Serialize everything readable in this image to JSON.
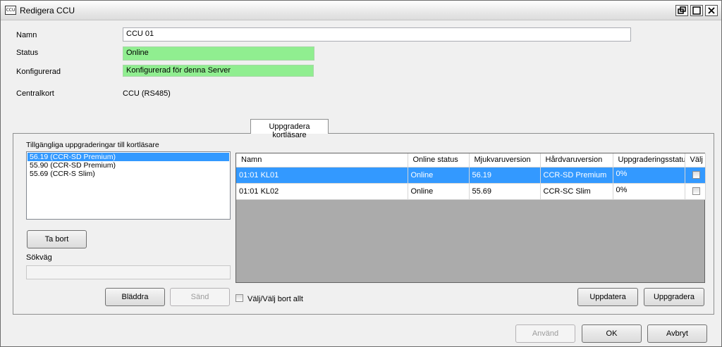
{
  "window": {
    "title": "Redigera CCU",
    "icon_text": "CCU"
  },
  "form": {
    "name_label": "Namn",
    "name_value": "CCU 01",
    "status_label": "Status",
    "status_value": "Online",
    "configured_label": "Konfigurerad",
    "configured_value": "Konfigurerad för denna Server",
    "board_label": "Centralkort",
    "board_value": "CCU (RS485)"
  },
  "tab": {
    "label": "Uppgradera kortläsare"
  },
  "upgrades": {
    "heading": "Tillgängliga uppgraderingar till kortläsare",
    "items": [
      {
        "label": "56.19 (CCR-SD Premium)",
        "selected": true
      },
      {
        "label": "55.90 (CCR-SD Premium)",
        "selected": false
      },
      {
        "label": "55.69 (CCR-S Slim)",
        "selected": false
      }
    ],
    "remove_button": "Ta bort",
    "path_label": "Sökväg",
    "path_value": "",
    "browse_button": "Bläddra",
    "send_button": "Sänd"
  },
  "readers": {
    "columns": [
      "Namn",
      "Online status",
      "Mjukvaruversion",
      "Hårdvaruversion",
      "Uppgraderingsstatus",
      "Välj"
    ],
    "rows": [
      {
        "name": "01:01 KL01",
        "online": "Online",
        "software": "56.19",
        "hardware": "CCR-SD Premium",
        "upgrade_status": "0%",
        "selected": true
      },
      {
        "name": "01:01 KL02",
        "online": "Online",
        "software": "55.69",
        "hardware": "CCR-SC Slim",
        "upgrade_status": "0%",
        "selected": false
      }
    ],
    "select_all_label": "Välj/Välj bort allt",
    "update_button": "Uppdatera",
    "upgrade_button": "Uppgradera"
  },
  "footer": {
    "apply_button": "Använd",
    "ok_button": "OK",
    "cancel_button": "Avbryt"
  },
  "colors": {
    "selection": "#3399ff",
    "status_green": "#90ee90"
  }
}
